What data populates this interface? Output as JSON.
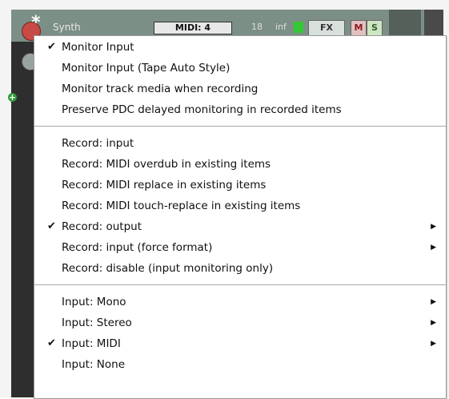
{
  "track": {
    "name": "Synth",
    "input_label": "MIDI: 4",
    "volume": "18",
    "pan": "inf",
    "fx_label": "FX",
    "mute_label": "M",
    "solo_label": "S"
  },
  "menu": {
    "groups": [
      {
        "items": [
          {
            "label": "Monitor Input",
            "checked": true,
            "submenu": false
          },
          {
            "label": "Monitor Input (Tape Auto Style)",
            "checked": false,
            "submenu": false
          },
          {
            "label": "Monitor track media when recording",
            "checked": false,
            "submenu": false
          },
          {
            "label": "Preserve PDC delayed monitoring in recorded items",
            "checked": false,
            "submenu": false
          }
        ]
      },
      {
        "items": [
          {
            "label": "Record: input",
            "checked": false,
            "submenu": false
          },
          {
            "label": "Record: MIDI overdub in existing items",
            "checked": false,
            "submenu": false
          },
          {
            "label": "Record: MIDI replace in existing items",
            "checked": false,
            "submenu": false
          },
          {
            "label": "Record: MIDI touch-replace in existing items",
            "checked": false,
            "submenu": false
          },
          {
            "label": "Record: output",
            "checked": true,
            "submenu": true
          },
          {
            "label": "Record: input (force format)",
            "checked": false,
            "submenu": true
          },
          {
            "label": "Record: disable (input monitoring only)",
            "checked": false,
            "submenu": false
          }
        ]
      },
      {
        "items": [
          {
            "label": "Input: Mono",
            "checked": false,
            "submenu": true
          },
          {
            "label": "Input: Stereo",
            "checked": false,
            "submenu": true
          },
          {
            "label": "Input: MIDI",
            "checked": true,
            "submenu": true
          },
          {
            "label": "Input: None",
            "checked": false,
            "submenu": false
          }
        ]
      }
    ],
    "check_glyph": "✔",
    "submenu_glyph": "▶"
  }
}
